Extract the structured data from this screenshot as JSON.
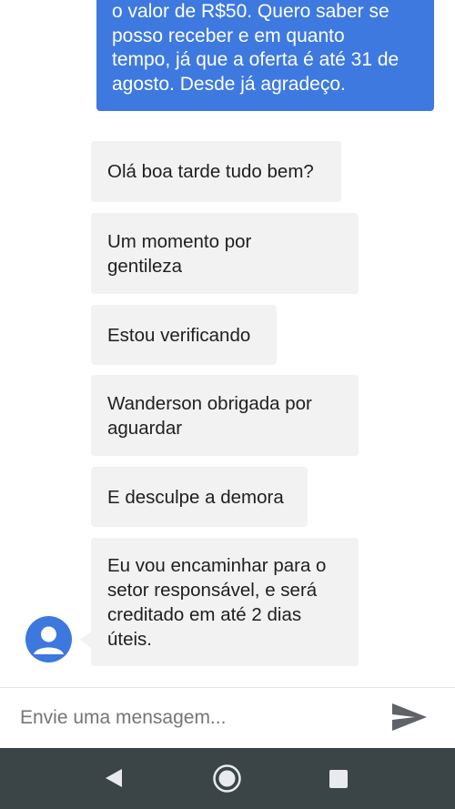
{
  "conversation": {
    "outgoing": [
      {
        "lines": [
          "o valor de R$50. Quero saber se",
          "posso receber e em quanto",
          "tempo, já que a oferta é até 31 de",
          "agosto. Desde já agradeço."
        ]
      }
    ],
    "incoming": [
      {
        "lines": [
          "Olá boa tarde tudo bem?"
        ]
      },
      {
        "lines": [
          "Um momento por",
          "gentileza"
        ]
      },
      {
        "lines": [
          "Estou verificando"
        ]
      },
      {
        "lines": [
          "Wanderson obrigada por",
          "aguardar"
        ]
      },
      {
        "lines": [
          "E desculpe a demora"
        ]
      },
      {
        "lines": [
          "Eu vou encaminhar para o",
          "setor responsável, e será",
          "creditado em até 2 dias",
          "úteis."
        ]
      }
    ],
    "agent_avatar_icon": "person-icon"
  },
  "composer": {
    "placeholder": "Envie uma mensagem...",
    "value": "",
    "send_icon": "send-icon"
  },
  "navigation_bar": {
    "back_icon": "back-triangle-icon",
    "home_icon": "home-circle-icon",
    "recents_icon": "recents-square-icon"
  },
  "colors": {
    "outgoing_bubble": "#3e79e0",
    "incoming_bubble": "#f2f2f2",
    "avatar": "#3c78de",
    "nav_bar": "#3b4446"
  }
}
